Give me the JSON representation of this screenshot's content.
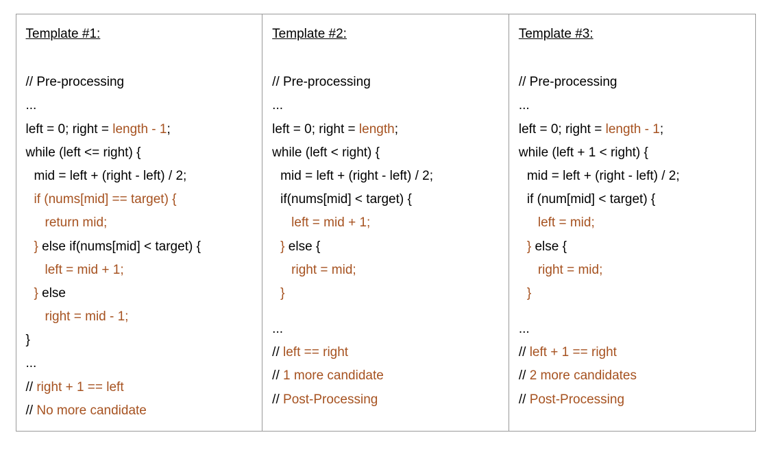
{
  "templates": [
    {
      "heading": "Template #1:",
      "lines": [
        {
          "cls": "",
          "segs": [
            {
              "t": "// Pre-processing",
              "hl": false
            }
          ]
        },
        {
          "cls": "",
          "segs": [
            {
              "t": "...",
              "hl": false
            }
          ]
        },
        {
          "cls": "",
          "segs": [
            {
              "t": "left = 0; right = ",
              "hl": false
            },
            {
              "t": "length - 1",
              "hl": true
            },
            {
              "t": ";",
              "hl": false
            }
          ]
        },
        {
          "cls": "",
          "segs": [
            {
              "t": "while (left <= right) {",
              "hl": false
            }
          ]
        },
        {
          "cls": "indent1",
          "segs": [
            {
              "t": "mid = left + (right - left) / 2;",
              "hl": false
            }
          ]
        },
        {
          "cls": "indent1",
          "segs": [
            {
              "t": "if (nums[mid] == target) {",
              "hl": true
            }
          ]
        },
        {
          "cls": "indent2",
          "segs": [
            {
              "t": "return mid;",
              "hl": true
            }
          ]
        },
        {
          "cls": "indent1",
          "segs": [
            {
              "t": "}",
              "hl": true
            },
            {
              "t": " else if(nums[mid] < target) {",
              "hl": false
            }
          ]
        },
        {
          "cls": "indent2",
          "segs": [
            {
              "t": "left = mid + 1;",
              "hl": true
            }
          ]
        },
        {
          "cls": "indent1",
          "segs": [
            {
              "t": "}",
              "hl": true
            },
            {
              "t": " else",
              "hl": false
            }
          ]
        },
        {
          "cls": "indent2",
          "segs": [
            {
              "t": "right = mid - 1;",
              "hl": true
            }
          ]
        },
        {
          "cls": "",
          "segs": [
            {
              "t": "}",
              "hl": false
            }
          ]
        },
        {
          "cls": "",
          "segs": [
            {
              "t": "...",
              "hl": false
            }
          ]
        },
        {
          "cls": "",
          "segs": [
            {
              "t": "// ",
              "hl": false
            },
            {
              "t": "right + 1 == left",
              "hl": true
            }
          ]
        },
        {
          "cls": "",
          "segs": [
            {
              "t": "// ",
              "hl": false
            },
            {
              "t": "No more candidate",
              "hl": true
            }
          ]
        }
      ]
    },
    {
      "heading": "Template #2:",
      "lines": [
        {
          "cls": "",
          "segs": [
            {
              "t": "// Pre-processing",
              "hl": false
            }
          ]
        },
        {
          "cls": "",
          "segs": [
            {
              "t": "...",
              "hl": false
            }
          ]
        },
        {
          "cls": "",
          "segs": [
            {
              "t": "left = 0; right = ",
              "hl": false
            },
            {
              "t": "length",
              "hl": true
            },
            {
              "t": ";",
              "hl": false
            }
          ]
        },
        {
          "cls": "",
          "segs": [
            {
              "t": "while (left < right) {",
              "hl": false
            }
          ]
        },
        {
          "cls": "indent1",
          "segs": [
            {
              "t": "mid = left + (right - left) / 2;",
              "hl": false
            }
          ]
        },
        {
          "cls": "indent1",
          "segs": [
            {
              "t": "if(nums[mid] < target) {",
              "hl": false
            }
          ]
        },
        {
          "cls": "indent2",
          "segs": [
            {
              "t": "left = mid  + 1;",
              "hl": true
            }
          ]
        },
        {
          "cls": "indent1",
          "segs": [
            {
              "t": "}",
              "hl": true
            },
            {
              "t": " else {",
              "hl": false
            }
          ]
        },
        {
          "cls": "indent2",
          "segs": [
            {
              "t": "right = mid;",
              "hl": true
            }
          ]
        },
        {
          "cls": "indent1",
          "segs": [
            {
              "t": "}",
              "hl": true
            }
          ]
        },
        {
          "cls": "gap",
          "segs": []
        },
        {
          "cls": "",
          "segs": [
            {
              "t": "...",
              "hl": false
            }
          ]
        },
        {
          "cls": "",
          "segs": [
            {
              "t": "// ",
              "hl": false
            },
            {
              "t": "left == right",
              "hl": true
            }
          ]
        },
        {
          "cls": "",
          "segs": [
            {
              "t": "// ",
              "hl": false
            },
            {
              "t": "1 more candidate",
              "hl": true
            }
          ]
        },
        {
          "cls": "",
          "segs": [
            {
              "t": "// ",
              "hl": false
            },
            {
              "t": "Post-Processing",
              "hl": true
            }
          ]
        }
      ]
    },
    {
      "heading": " Template #3:",
      "lines": [
        {
          "cls": "",
          "segs": [
            {
              "t": "// Pre-processing",
              "hl": false
            }
          ]
        },
        {
          "cls": "",
          "segs": [
            {
              "t": "...",
              "hl": false
            }
          ]
        },
        {
          "cls": "",
          "segs": [
            {
              "t": "left = 0; right = ",
              "hl": false
            },
            {
              "t": "length - 1",
              "hl": true
            },
            {
              "t": ";",
              "hl": false
            }
          ]
        },
        {
          "cls": "",
          "segs": [
            {
              "t": "while (left + 1 < right) {",
              "hl": false
            }
          ]
        },
        {
          "cls": "indent1",
          "segs": [
            {
              "t": "mid = left + (right - left) / 2;",
              "hl": false
            }
          ]
        },
        {
          "cls": "indent1",
          "segs": [
            {
              "t": "if (num[mid] < target) {",
              "hl": false
            }
          ]
        },
        {
          "cls": "indent2",
          "segs": [
            {
              "t": "left = mid;",
              "hl": true
            }
          ]
        },
        {
          "cls": "indent1",
          "segs": [
            {
              "t": "}",
              "hl": true
            },
            {
              "t": " else {",
              "hl": false
            }
          ]
        },
        {
          "cls": "indent2",
          "segs": [
            {
              "t": "right = mid;",
              "hl": true
            }
          ]
        },
        {
          "cls": "indent1",
          "segs": [
            {
              "t": "}",
              "hl": true
            }
          ]
        },
        {
          "cls": "gap",
          "segs": []
        },
        {
          "cls": "",
          "segs": [
            {
              "t": "...",
              "hl": false
            }
          ]
        },
        {
          "cls": "",
          "segs": [
            {
              "t": "// ",
              "hl": false
            },
            {
              "t": "left + 1 == right",
              "hl": true
            }
          ]
        },
        {
          "cls": "",
          "segs": [
            {
              "t": "// ",
              "hl": false
            },
            {
              "t": "2 more candidates",
              "hl": true
            }
          ]
        },
        {
          "cls": "",
          "segs": [
            {
              "t": "// ",
              "hl": false
            },
            {
              "t": "Post-Processing",
              "hl": true
            }
          ]
        }
      ]
    }
  ]
}
